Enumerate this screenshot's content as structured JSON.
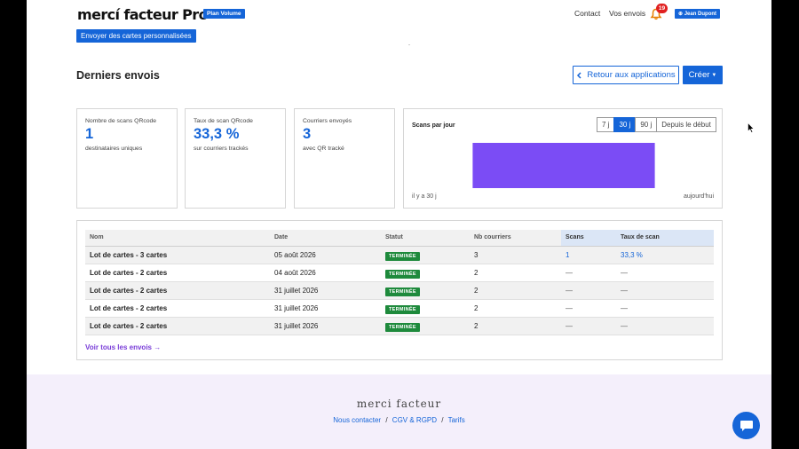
{
  "header": {
    "logo": "mercí facteur Pro",
    "plan_badge": "Plan Volume",
    "send_button": "Envoyer des cartes personnalisées",
    "nav_contact": "Contact",
    "nav_envois": "Vos envois",
    "notification_count": "19",
    "user": "⊕ Jean Dupont"
  },
  "title_row": {
    "title": "Derniers envois",
    "back_button": "Retour aux applications",
    "create_button": "Créer"
  },
  "stats": [
    {
      "label": "Nombre de scans QRcode",
      "value": "1",
      "sub": "destinataires uniques"
    },
    {
      "label": "Taux de scan QRcode",
      "value": "33,3 %",
      "sub": "sur courriers trackés"
    },
    {
      "label": "Courriers envoyés",
      "value": "3",
      "sub": "avec QR tracké"
    }
  ],
  "chart": {
    "title": "Scans par jour",
    "ranges": [
      "7 j",
      "30 j",
      "90 j",
      "Depuis le début"
    ],
    "active_range": "30 j",
    "axis_start": "il y a 30 j",
    "axis_end": "aujourd'hui",
    "bar_color": "#7b4cf5"
  },
  "chart_data": {
    "type": "bar",
    "title": "Scans par jour",
    "x_start_label": "il y a 30 j",
    "x_end_label": "aujourd'hui",
    "bars": [
      {
        "start_day": 24,
        "end_day": 6,
        "value": 1
      }
    ],
    "ylim": [
      0,
      1
    ]
  },
  "table": {
    "headers": [
      "Nom",
      "Date",
      "Statut",
      "Nb courriers",
      "Scans",
      "Taux de scan"
    ],
    "rows": [
      {
        "name": "Lot de cartes - 3 cartes",
        "date": "05 août 2026",
        "status": "TERMINÉE",
        "count": "3",
        "scans": "1",
        "rate": "33,3 %"
      },
      {
        "name": "Lot de cartes - 2 cartes",
        "date": "04 août 2026",
        "status": "TERMINÉE",
        "count": "2",
        "scans": "—",
        "rate": "—"
      },
      {
        "name": "Lot de cartes - 2 cartes",
        "date": "31 juillet 2026",
        "status": "TERMINÉE",
        "count": "2",
        "scans": "—",
        "rate": "—"
      },
      {
        "name": "Lot de cartes - 2 cartes",
        "date": "31 juillet 2026",
        "status": "TERMINÉE",
        "count": "2",
        "scans": "—",
        "rate": "—"
      },
      {
        "name": "Lot de cartes - 2 cartes",
        "date": "31 juillet 2026",
        "status": "TERMINÉE",
        "count": "2",
        "scans": "—",
        "rate": "—"
      }
    ],
    "see_all": "Voir tous les envois →"
  },
  "footer": {
    "brand": "merci facteur",
    "links": [
      "Nous contacter",
      "CGV & RGPD",
      "Tarifs"
    ],
    "separator": "/"
  },
  "colors": {
    "accent": "#1565d8",
    "status_green": "#1e8a3c",
    "chart_purple": "#7b4cf5",
    "link_purple": "#7a3ed8",
    "footer_bg": "#f4effb"
  }
}
